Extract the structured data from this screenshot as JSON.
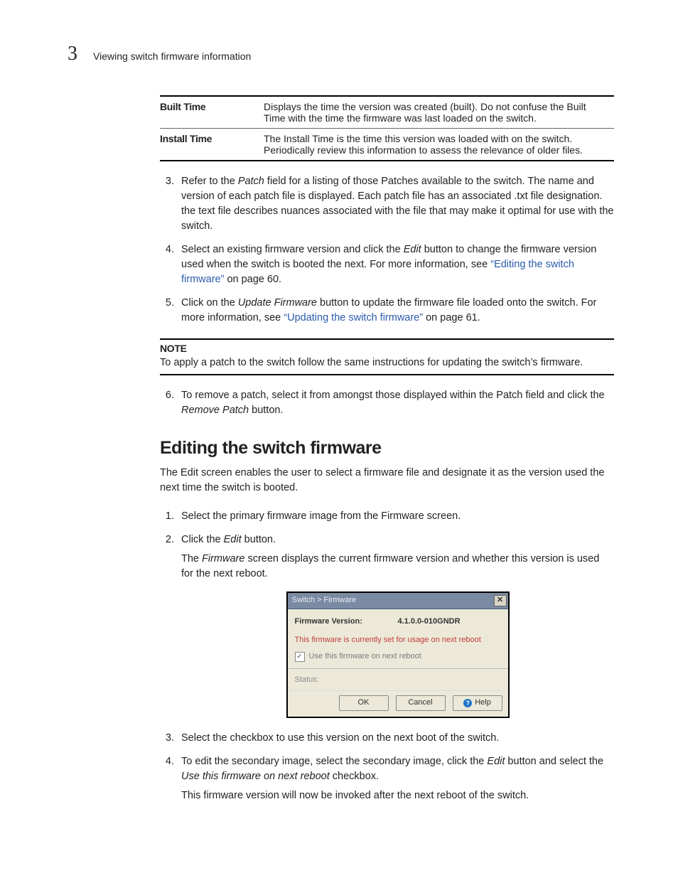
{
  "header": {
    "chapter_number": "3",
    "title": "Viewing switch firmware information"
  },
  "info_table": {
    "rows": [
      {
        "label": "Built Time",
        "desc": "Displays the time the version was created (built). Do not confuse the Built Time with the time the firmware was last loaded on the switch."
      },
      {
        "label": "Install Time",
        "desc": "The Install Time is the time this version was loaded with on the switch. Periodically review this information to assess the relevance of older files."
      }
    ]
  },
  "steps_a": {
    "start": 3,
    "items": [
      {
        "pre": "Refer to the ",
        "em1": "Patch",
        "post": " field for a listing of those Patches available to the switch. The name and version of each patch file is displayed. Each patch file has an associated .txt file designation. the text file describes nuances associated with the file that may make it optimal for use with the switch."
      },
      {
        "pre": "Select an existing firmware version and click the ",
        "em1": "Edit",
        "mid": " button to change the firmware version used when the switch is booted the next. For more information, see ",
        "link": "“Editing the switch firmware”",
        "post_link": " on page 60."
      },
      {
        "pre": "Click on the ",
        "em1": "Update Firmware",
        "mid": " button to update the firmware file loaded onto the switch. For more information, see ",
        "link": "“Updating the switch firmware”",
        "post_link": " on page 61."
      }
    ]
  },
  "note": {
    "title": "NOTE",
    "body": "To apply a patch to the switch follow the same instructions for updating the switch’s firmware."
  },
  "steps_b": {
    "start": 6,
    "items": [
      {
        "pre": "To remove a patch, select it from amongst those displayed within the Patch field and click the ",
        "em1": "Remove Patch",
        "post": " button."
      }
    ]
  },
  "section": {
    "title": "Editing the switch firmware",
    "intro": "The Edit screen enables the user to select a firmware file and designate it as the version used the next time the switch is booted."
  },
  "steps_c": {
    "start": 1,
    "items": [
      {
        "text": "Select the primary firmware image from the Firmware screen."
      },
      {
        "pre": "Click the ",
        "em1": "Edit",
        "post": " button.",
        "sub_pre": "The ",
        "sub_em": "Firmware",
        "sub_post": " screen displays the current firmware version and whether this version is used for the next reboot."
      }
    ]
  },
  "dialog": {
    "title": "Switch > Firmware",
    "close_label": "✕",
    "fv_label": "Firmware Version:",
    "fv_value": "4.1.0.0-010GNDR",
    "notice": "This firmware is currently set for usage on next reboot",
    "checkbox_label": "Use this firmware on next reboot",
    "checkbox_checked": true,
    "status_label": "Status:",
    "buttons": {
      "ok": "OK",
      "cancel": "Cancel",
      "help": "Help"
    }
  },
  "steps_d": {
    "start": 3,
    "items": [
      {
        "text": "Select the checkbox to use this version on the next boot of the switch."
      },
      {
        "pre": "To edit the secondary image, select the secondary image, click the ",
        "em1": "Edit",
        "mid": " button and select the ",
        "em2": "Use this firmware on next reboot",
        "post": " checkbox.",
        "sub": "This firmware version will now be invoked after the next reboot of the switch."
      }
    ]
  }
}
